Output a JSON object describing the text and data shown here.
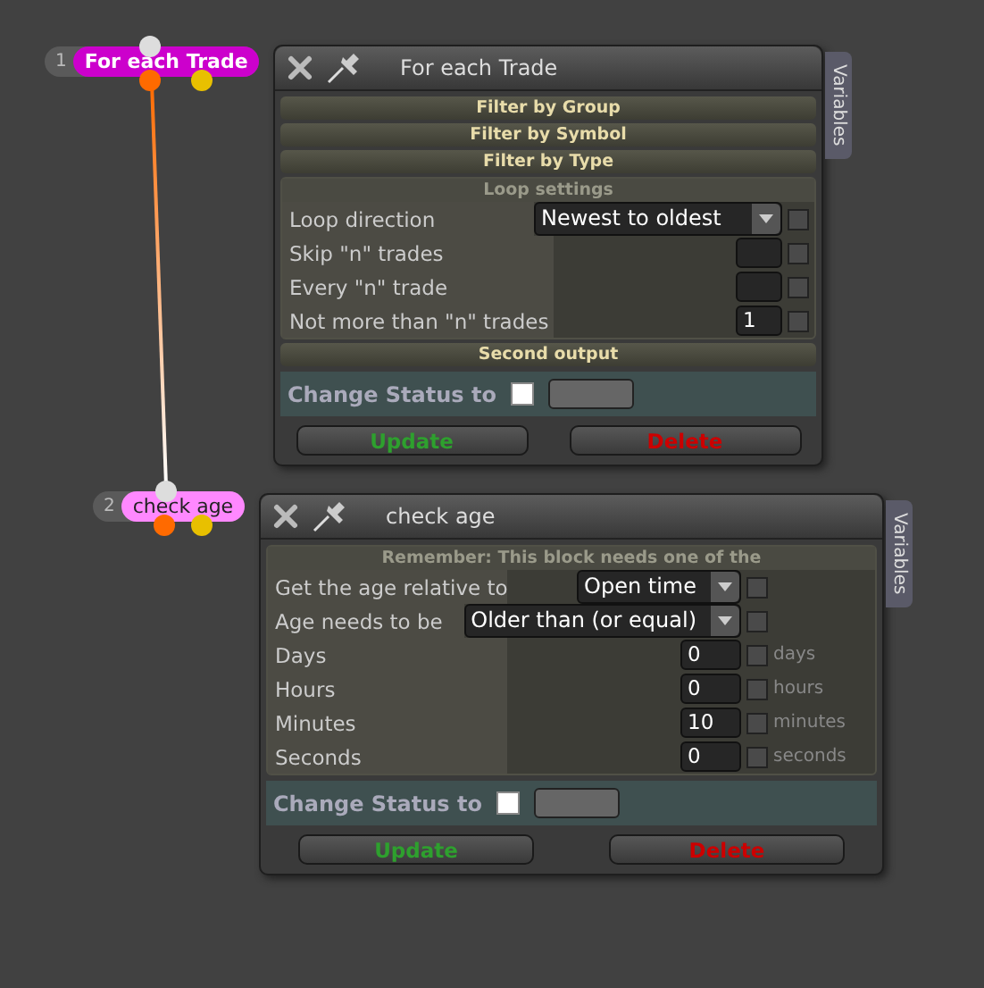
{
  "nodes": [
    {
      "number": "1",
      "label": "For each Trade",
      "color": "#cc00cc"
    },
    {
      "number": "2",
      "label": "check age",
      "color": "#ff88ff"
    }
  ],
  "windows": [
    {
      "title": "For each Trade",
      "tab": "Variables",
      "items": [
        {
          "kind": "section",
          "label": "Filter by Group"
        },
        {
          "kind": "section",
          "label": "Filter by Symbol"
        },
        {
          "kind": "section",
          "label": "Filter by Type"
        },
        {
          "kind": "group",
          "label": "Loop settings",
          "rows": [
            {
              "label": "Loop direction",
              "kind": "select",
              "value": "Newest to oldest",
              "checked": false
            },
            {
              "label": "Skip \"n\" trades",
              "kind": "number",
              "checked": false
            },
            {
              "label": "Every \"n\" trade",
              "kind": "number",
              "checked": false
            },
            {
              "label": "Not more than \"n\" trades",
              "kind": "number",
              "value": "1",
              "checked": false
            }
          ]
        },
        {
          "kind": "section",
          "label": "Second output"
        }
      ],
      "status_label": "Change Status to",
      "status_checked": false,
      "buttons": [
        {
          "label": "Update",
          "kind": "update"
        },
        {
          "label": "Delete",
          "kind": "delete"
        }
      ]
    },
    {
      "title": "check age",
      "tab": "Variables",
      "items": [
        {
          "kind": "group",
          "label": "Remember: This block needs one of the",
          "rows": [
            {
              "label": "Get the age relative to",
              "kind": "select",
              "value": "Open time",
              "checked": false
            },
            {
              "label": "Age needs to be",
              "kind": "select",
              "value": "Older than (or equal)",
              "checked": false
            },
            {
              "label": "Days",
              "kind": "number",
              "value": "0",
              "checked": false,
              "unit": "days"
            },
            {
              "label": "Hours",
              "kind": "number",
              "value": "0",
              "checked": false,
              "unit": "hours"
            },
            {
              "label": "Minutes",
              "kind": "number",
              "value": "10",
              "checked": false,
              "unit": "minutes"
            },
            {
              "label": "Seconds",
              "kind": "number",
              "value": "0",
              "checked": false,
              "unit": "seconds"
            }
          ]
        }
      ],
      "status_label": "Change Status to",
      "status_checked": false,
      "buttons": [
        {
          "label": "Update",
          "kind": "update"
        },
        {
          "label": "Delete",
          "kind": "delete"
        }
      ]
    }
  ]
}
